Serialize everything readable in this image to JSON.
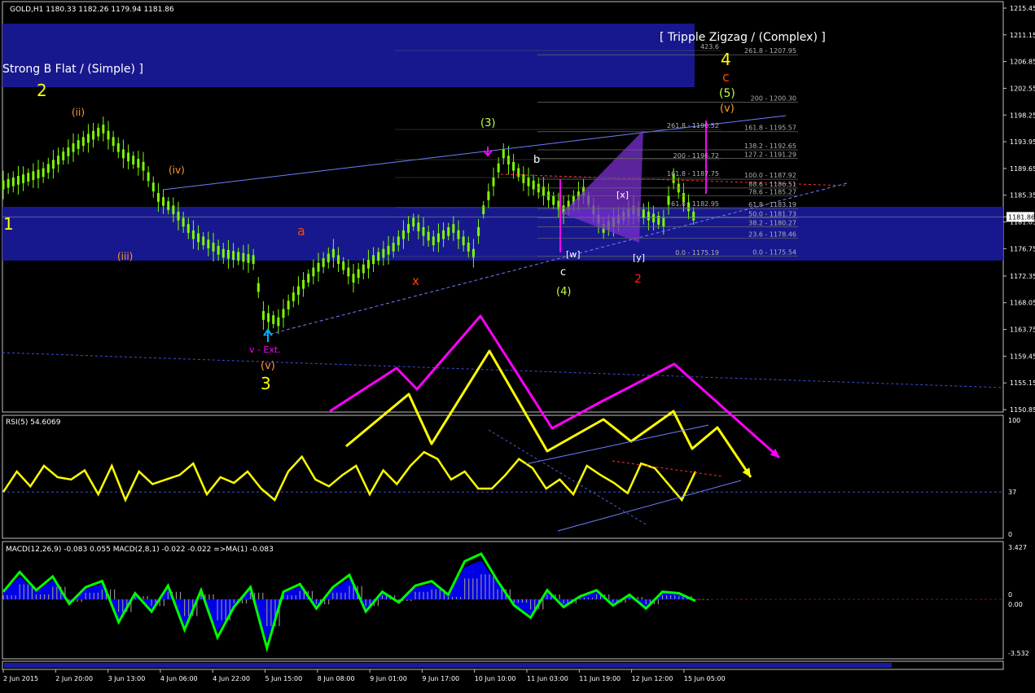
{
  "window": {
    "symbol_header": "GOLD,H1  1180.33 1182.26 1179.94 1181.86",
    "current_price_tag": "1181.86"
  },
  "colors": {
    "background": "#000000",
    "band": "#1a1a9a",
    "candle": "#7CFC00",
    "rsi": "#ffff00",
    "macd_line": "#00ff00",
    "macd_hist": "#0000ff",
    "arrow_magenta": "#ff00ff",
    "arrow_yellow": "#ffff00",
    "fib": "#b0b0b0"
  },
  "chart_data": [
    {
      "type": "line",
      "panel": "price",
      "title": "GOLD,H1",
      "y_ticks": [
        "1215.45",
        "1211.15",
        "1206.85",
        "1202.55",
        "1198.25",
        "1193.95",
        "1189.65",
        "1185.35",
        "1181.86",
        "1181.05",
        "1176.75",
        "1172.35",
        "1168.05",
        "1163.75",
        "1159.45",
        "1155.15",
        "1150.85"
      ],
      "ylim": [
        1150.85,
        1215.45
      ],
      "x_ticks": [
        "2 Jun 2015",
        "2 Jun 20:00",
        "3 Jun 13:00",
        "4 Jun 06:00",
        "4 Jun 22:00",
        "5 Jun 15:00",
        "8 Jun 08:00",
        "9 Jun 01:00",
        "9 Jun 17:00",
        "10 Jun 10:00",
        "11 Jun 03:00",
        "11 Jun 19:00",
        "12 Jun 12:00",
        "15 Jun 05:00"
      ],
      "approx_close_path": [
        [
          0,
          1187
        ],
        [
          8,
          1189
        ],
        [
          14,
          1193
        ],
        [
          20,
          1196
        ],
        [
          24,
          1192
        ],
        [
          28,
          1190
        ],
        [
          31,
          1185
        ],
        [
          34,
          1183
        ],
        [
          38,
          1179
        ],
        [
          44,
          1176
        ],
        [
          50,
          1175
        ],
        [
          52,
          1166
        ],
        [
          55,
          1165
        ],
        [
          58,
          1169
        ],
        [
          62,
          1173
        ],
        [
          66,
          1176
        ],
        [
          70,
          1172
        ],
        [
          74,
          1175
        ],
        [
          78,
          1177
        ],
        [
          82,
          1181
        ],
        [
          86,
          1178
        ],
        [
          90,
          1180
        ],
        [
          94,
          1176
        ],
        [
          96,
          1183
        ],
        [
          100,
          1192
        ],
        [
          104,
          1188
        ],
        [
          108,
          1186
        ],
        [
          112,
          1183
        ],
        [
          116,
          1186
        ],
        [
          120,
          1180
        ],
        [
          126,
          1183
        ],
        [
          132,
          1181
        ],
        [
          134,
          1188
        ],
        [
          138,
          1182
        ]
      ],
      "labels": {
        "top_right": "[ Tripple Zigzag / (Complex) ]",
        "top_left": "Strong B Flat / (Simple) ]",
        "wave_marks": [
          "1",
          "2",
          "3",
          "4",
          "c",
          "(5)",
          "(v)",
          "(iv)",
          "(ii)",
          "(iii)",
          "(3)",
          "(4)",
          "b",
          "a",
          "x",
          "v - Ext.",
          "(v)",
          "[w]",
          "[x]",
          "[y]",
          "2",
          "c"
        ]
      },
      "fib_right": [
        "261.8 - 1207.95",
        "200 - 1200.30",
        "161.8 - 1195.57",
        "138.2 - 1192.65",
        "127.2 - 1191.29",
        "100.0 - 1187.92",
        "88.6 - 1186.51",
        "78.6 - 1185.27",
        "61.8 - 1183.19",
        "50.0 - 1181.73",
        "38.2 - 1180.27",
        "23.6 - 1178.46",
        "0.0 - 1175.54"
      ],
      "fib_left": [
        "423.6",
        "261.8 - 1196.52",
        "200 - 1196.72",
        "161.8 - 1187.75",
        "61.8 - 1182.95",
        "0.0 - 1175.19"
      ]
    },
    {
      "type": "line",
      "panel": "rsi",
      "title": "RSI(5) 54.6069",
      "ylim": [
        0,
        100
      ],
      "y_ticks": [
        "100",
        "37",
        "0"
      ],
      "level": 37,
      "values": [
        37,
        55,
        42,
        60,
        50,
        48,
        56,
        35,
        60,
        30,
        55,
        44,
        48,
        52,
        62,
        35,
        50,
        45,
        55,
        40,
        30,
        55,
        68,
        48,
        42,
        52,
        60,
        35,
        56,
        44,
        60,
        72,
        66,
        48,
        55,
        40,
        40,
        52,
        66,
        58,
        40,
        48,
        35,
        60,
        52,
        45,
        36,
        62,
        58,
        44,
        30,
        55
      ]
    },
    {
      "type": "bar",
      "panel": "macd",
      "title": "MACD(12,26,9) -0.083 0.055  MACD(2,8,1) -0.022 -0.022  =>MA(1) -0.083",
      "y_ticks": [
        "3.427",
        "0",
        "0.00",
        "-3.532"
      ],
      "ylim": [
        -3.532,
        3.427
      ],
      "values": [
        0.5,
        1.8,
        0.6,
        1.5,
        -0.3,
        0.8,
        1.2,
        -1.5,
        0.4,
        -0.8,
        0.9,
        -2.0,
        0.6,
        -2.5,
        -0.5,
        0.8,
        -3.2,
        0.5,
        1.0,
        -0.6,
        0.8,
        1.6,
        -0.8,
        0.5,
        -0.2,
        0.9,
        1.2,
        0.3,
        2.5,
        3.0,
        1.2,
        -0.4,
        -1.2,
        0.6,
        -0.5,
        0.2,
        0.6,
        -0.4,
        0.3,
        -0.6,
        0.5,
        0.4,
        -0.1
      ]
    }
  ]
}
